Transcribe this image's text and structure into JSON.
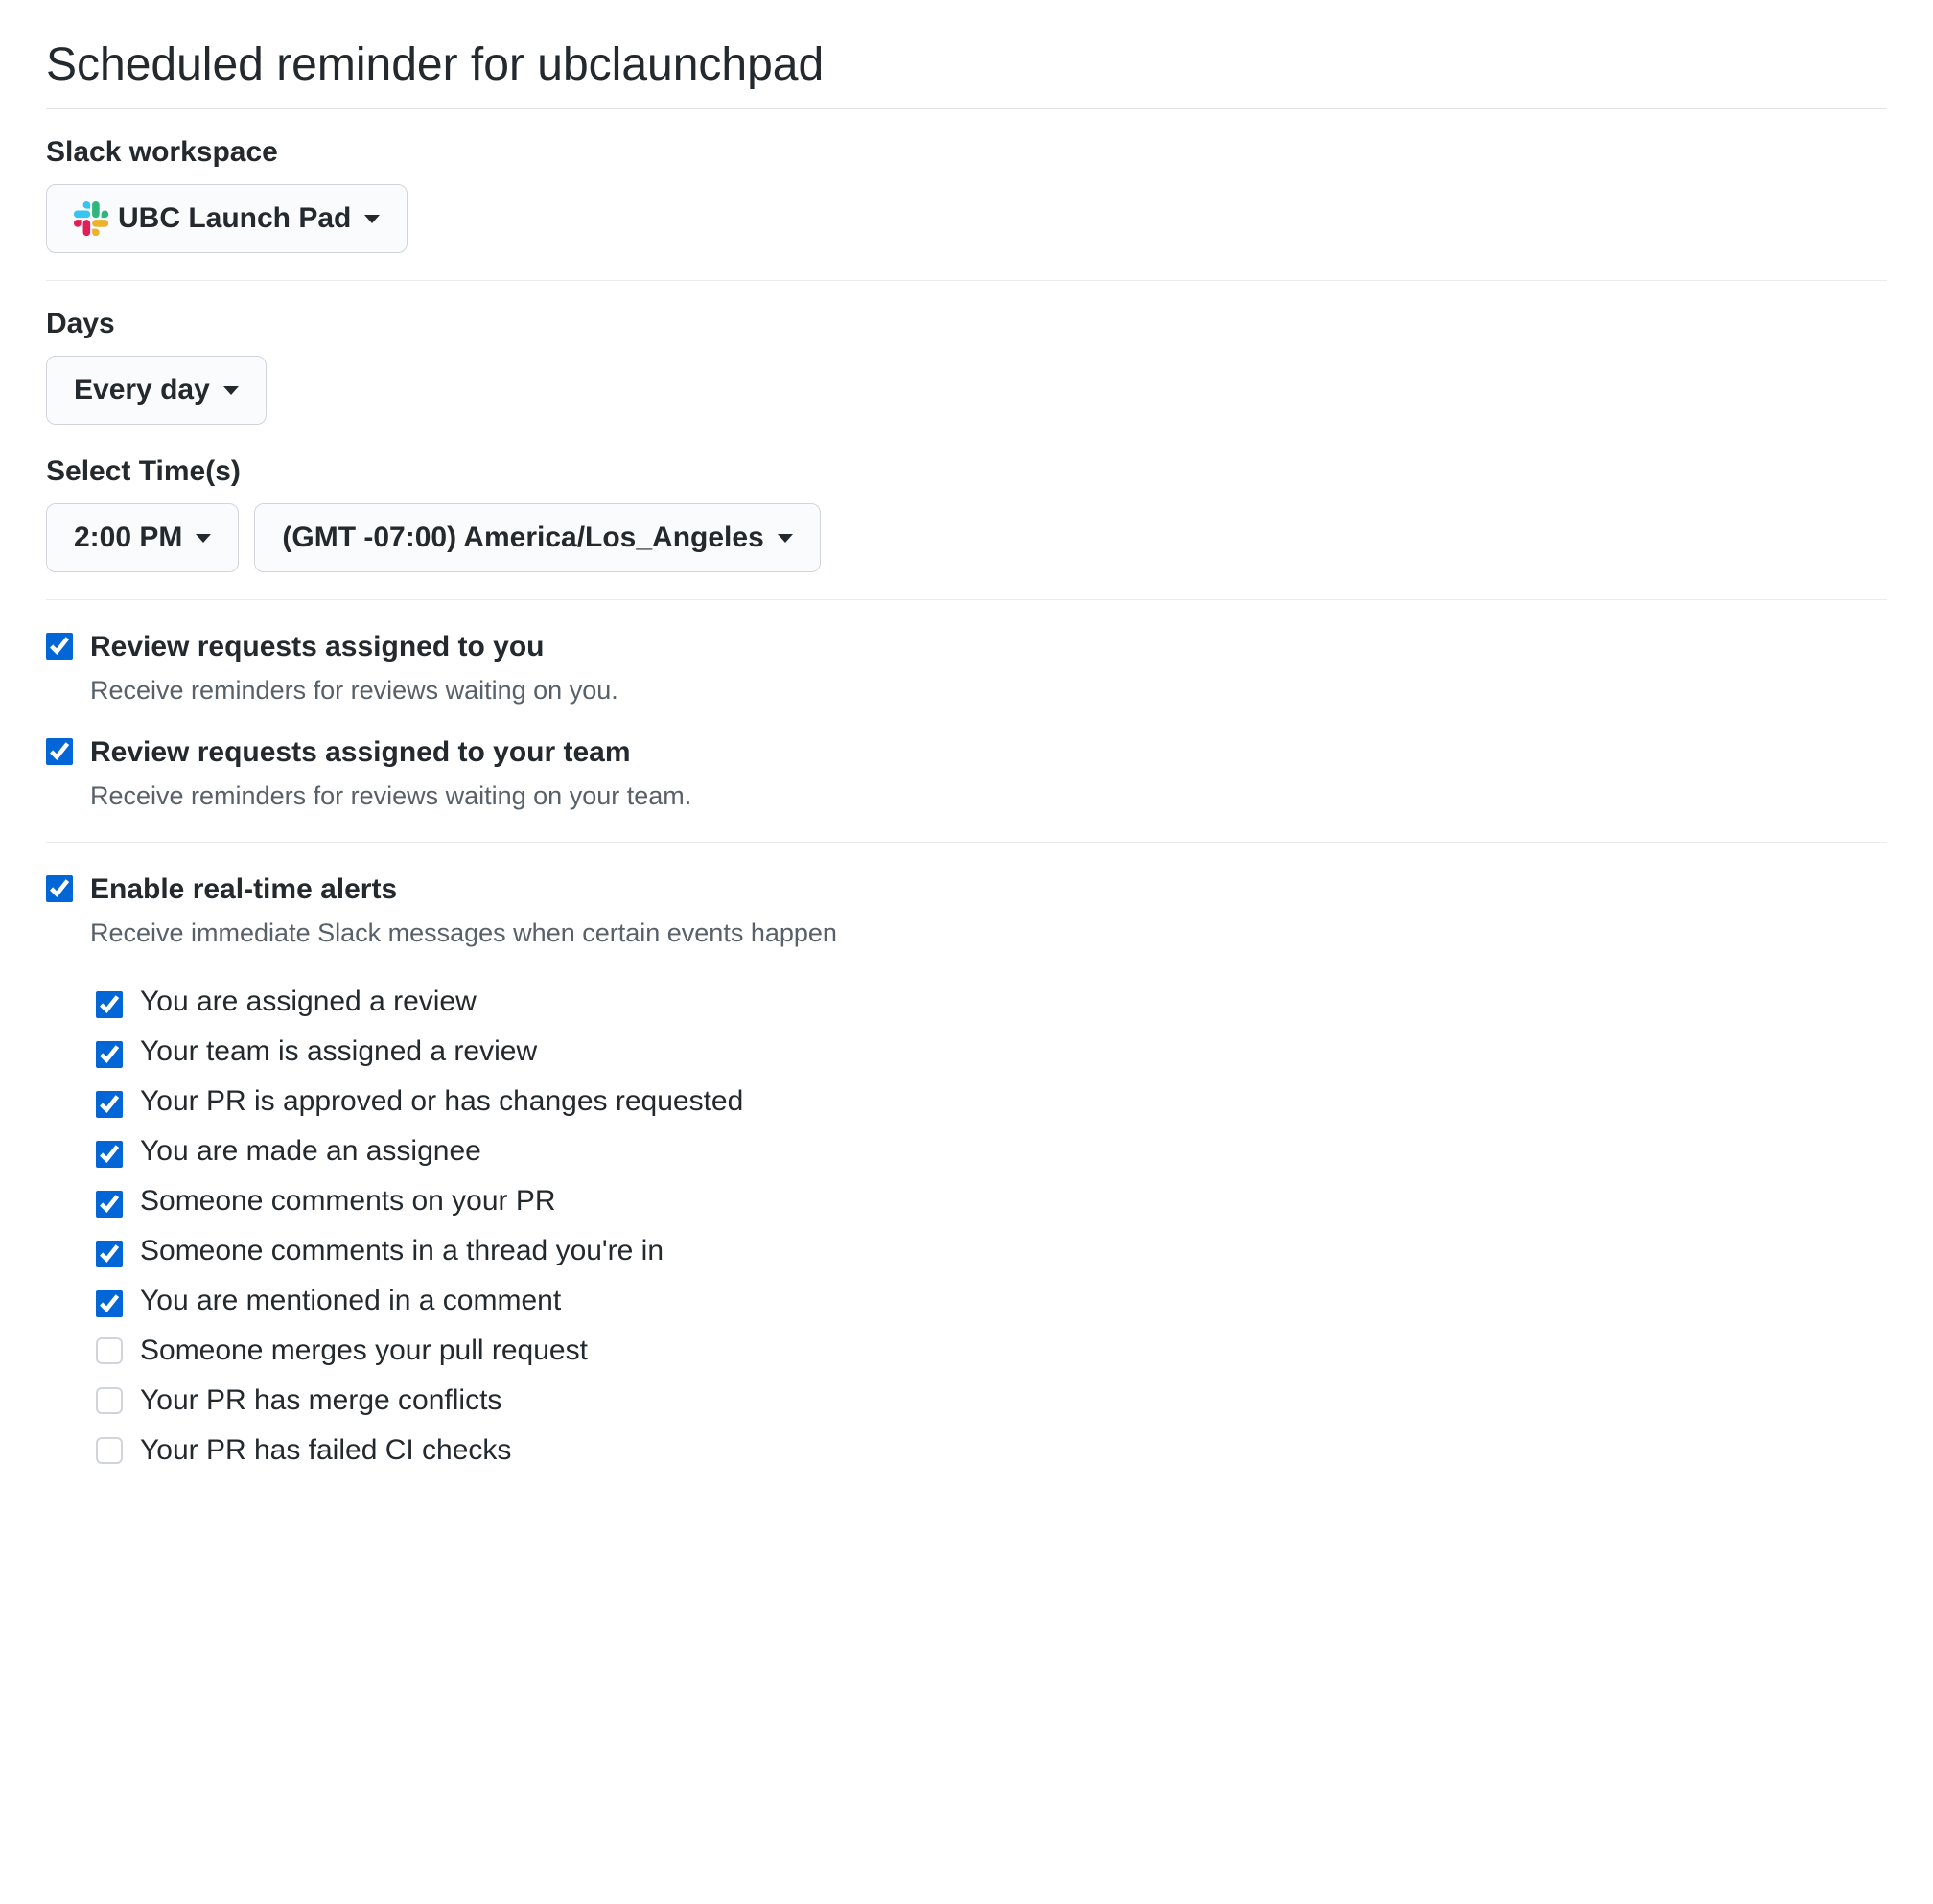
{
  "page_title": "Scheduled reminder for ubclaunchpad",
  "workspace": {
    "label": "Slack workspace",
    "selected": "UBC Launch Pad"
  },
  "days": {
    "label": "Days",
    "selected": "Every day"
  },
  "time": {
    "label": "Select Time(s)",
    "selected_time": "2:00 PM",
    "selected_tz": "(GMT -07:00) America/Los_Angeles"
  },
  "review_you": {
    "title": "Review requests assigned to you",
    "desc": "Receive reminders for reviews waiting on you.",
    "checked": true
  },
  "review_team": {
    "title": "Review requests assigned to your team",
    "desc": "Receive reminders for reviews waiting on your team.",
    "checked": true
  },
  "realtime": {
    "title": "Enable real-time alerts",
    "desc": "Receive immediate Slack messages when certain events happen",
    "checked": true,
    "alerts": [
      {
        "label": "You are assigned a review",
        "checked": true
      },
      {
        "label": "Your team is assigned a review",
        "checked": true
      },
      {
        "label": "Your PR is approved or has changes requested",
        "checked": true
      },
      {
        "label": "You are made an assignee",
        "checked": true
      },
      {
        "label": "Someone comments on your PR",
        "checked": true
      },
      {
        "label": "Someone comments in a thread you're in",
        "checked": true
      },
      {
        "label": "You are mentioned in a comment",
        "checked": true
      },
      {
        "label": "Someone merges your pull request",
        "checked": false
      },
      {
        "label": "Your PR has merge conflicts",
        "checked": false
      },
      {
        "label": "Your PR has failed CI checks",
        "checked": false
      }
    ]
  }
}
